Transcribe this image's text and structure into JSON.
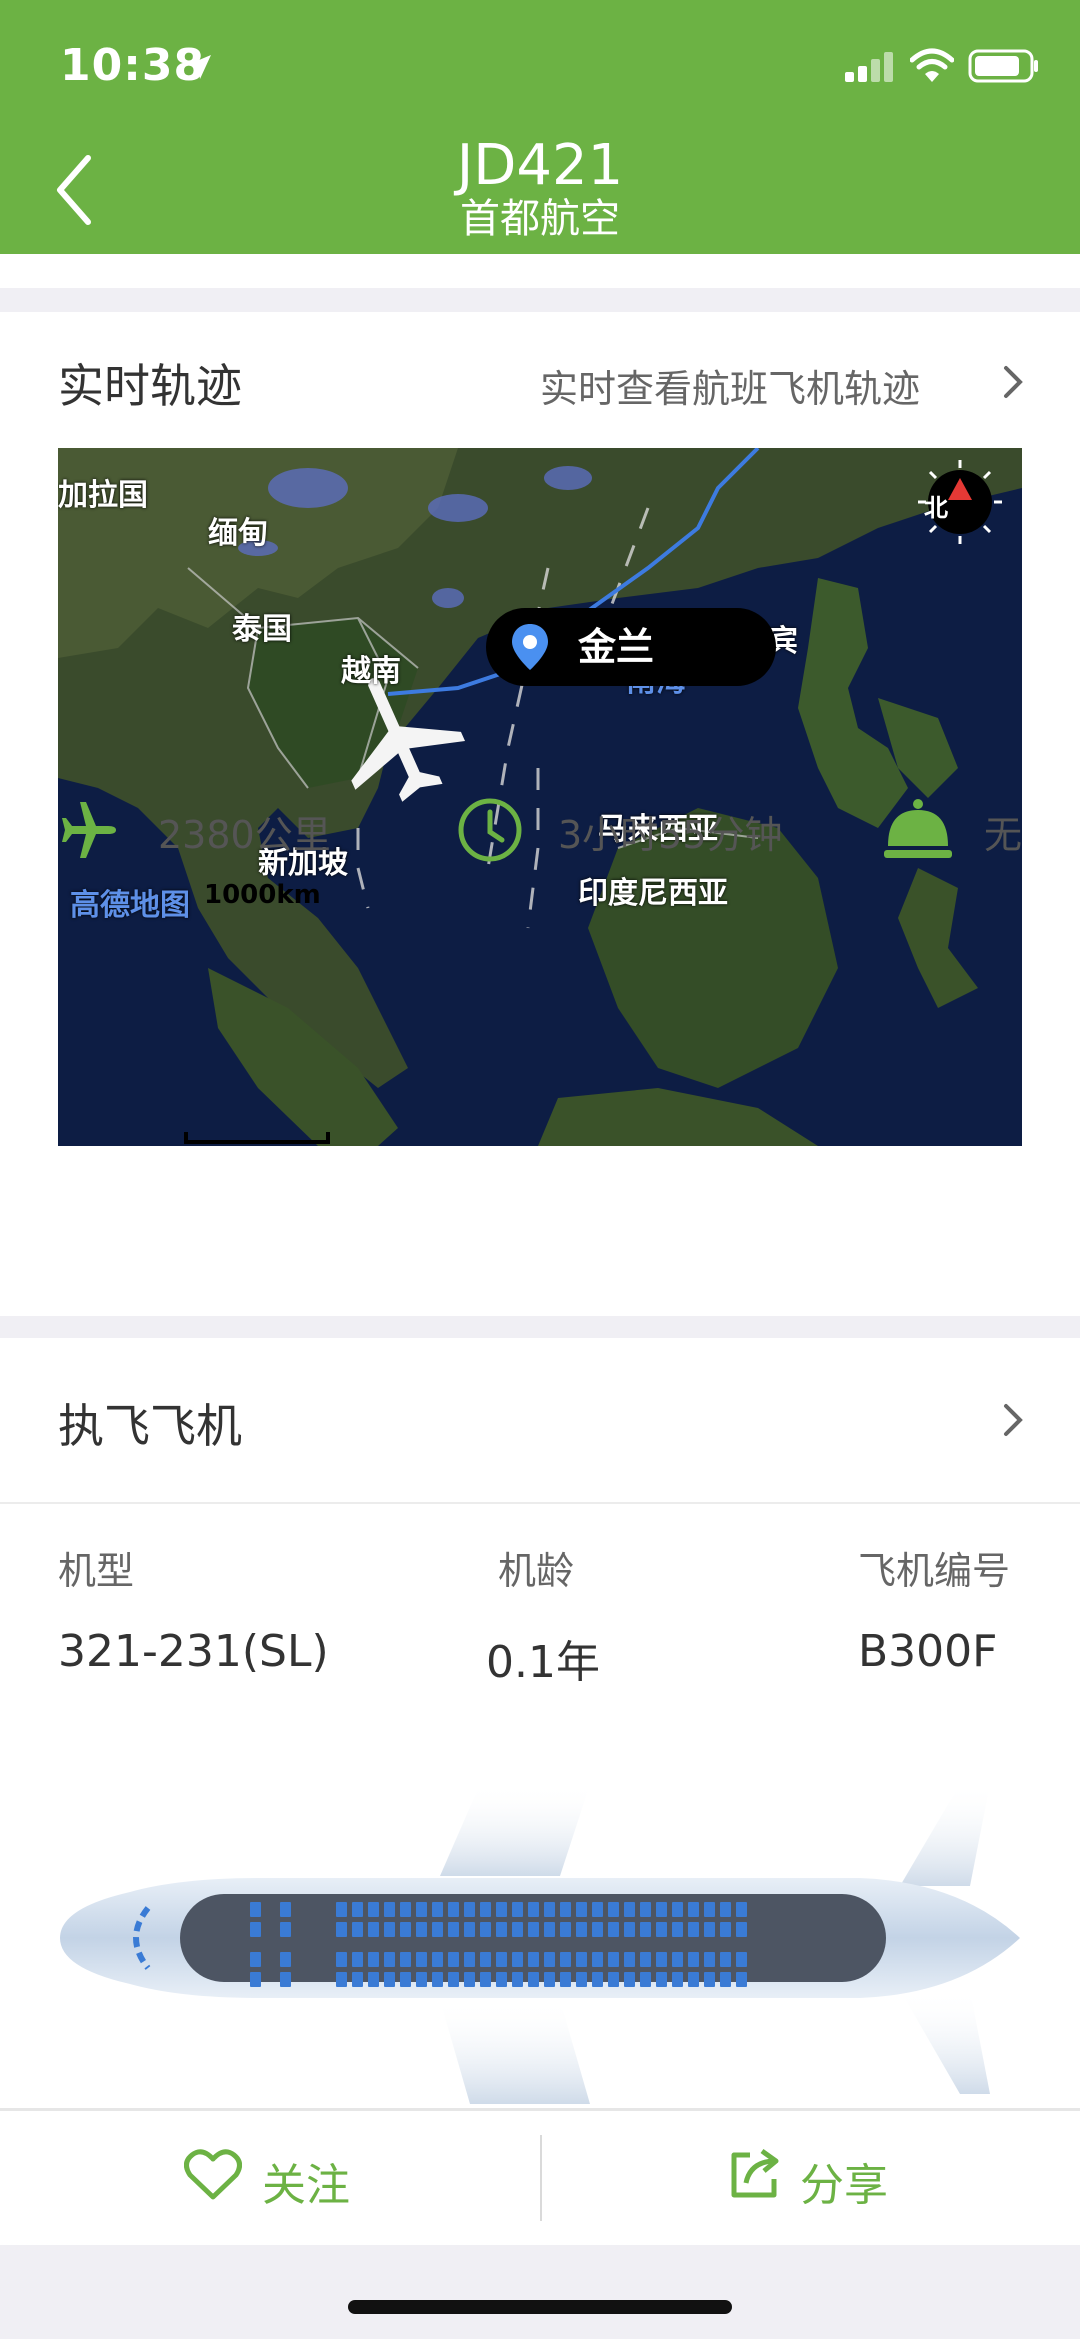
{
  "status_bar": {
    "time": "10:38"
  },
  "header": {
    "flight_no": "JD421",
    "airline": "首都航空"
  },
  "track_section": {
    "title": "实时轨迹",
    "link_text": "实时查看航班飞机轨迹",
    "map": {
      "current_location": "金兰",
      "compass_label": "北",
      "map_logo": "高德地图",
      "scale": "1000km",
      "labels": {
        "bangladesh": "加拉国",
        "myanmar": "缅甸",
        "thailand": "泰国",
        "vietnam": "越南",
        "south_sea": "南海",
        "philippines": "菲律宾",
        "malaysia": "马来西亚",
        "singapore": "新加坡",
        "indonesia": "印度尼西亚"
      }
    },
    "stats": {
      "distance": "2380公里",
      "duration": "3小时55分钟",
      "meal": "无"
    }
  },
  "aircraft_section": {
    "title": "执飞飞机",
    "model_label": "机型",
    "model_value": "321-231(SL)",
    "age_label": "机龄",
    "age_value": "0.1年",
    "reg_label": "飞机编号",
    "reg_value": "B300F"
  },
  "actions": {
    "follow": "关注",
    "share": "分享"
  },
  "colors": {
    "brand_green": "#6cb244",
    "route_blue": "#3d7be0",
    "seat_blue": "#3a7bd5"
  }
}
